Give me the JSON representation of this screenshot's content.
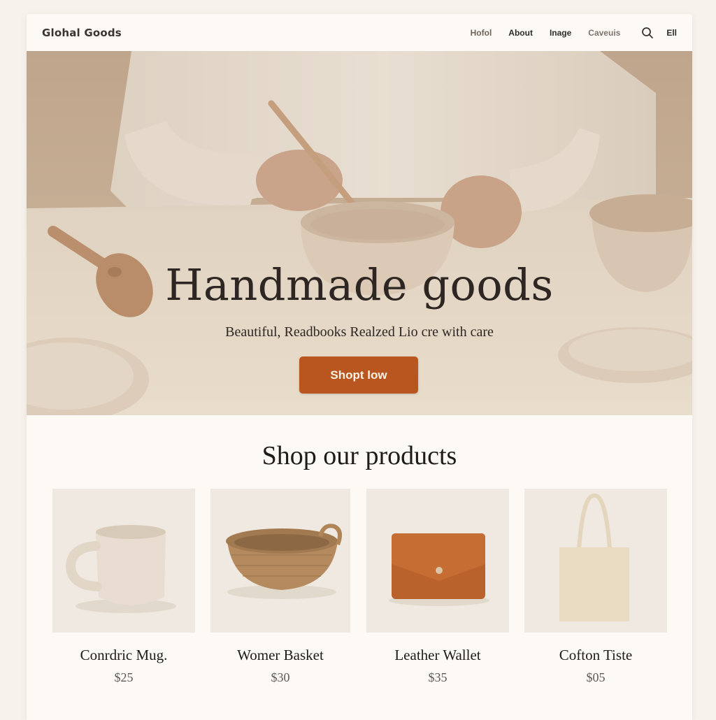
{
  "header": {
    "logo": "Glohal Goods",
    "nav": [
      {
        "label": "Hofol"
      },
      {
        "label": "About"
      },
      {
        "label": "Inage"
      },
      {
        "label": "Caveuis"
      }
    ],
    "search_icon": "search-icon",
    "lang_label": "Ell"
  },
  "hero": {
    "title": "Handmade goods",
    "subtitle": "Beautiful, Readbooks Realzed Lio cre with care",
    "cta_label": "Shopt low",
    "cta_color": "#b9561f"
  },
  "products": {
    "title": "Shop our products",
    "items": [
      {
        "name": "Conrdric Mug.",
        "price": "$25",
        "image": "ceramic-mug"
      },
      {
        "name": "Womer Basket",
        "price": "$30",
        "image": "woven-basket"
      },
      {
        "name": "Leather Wallet",
        "price": "$35",
        "image": "leather-wallet"
      },
      {
        "name": "Cofton Tiste",
        "price": "$05",
        "image": "cotton-tote"
      }
    ]
  },
  "colors": {
    "accent": "#b9561f",
    "background": "#fdfaf5",
    "text": "#2d2622"
  }
}
